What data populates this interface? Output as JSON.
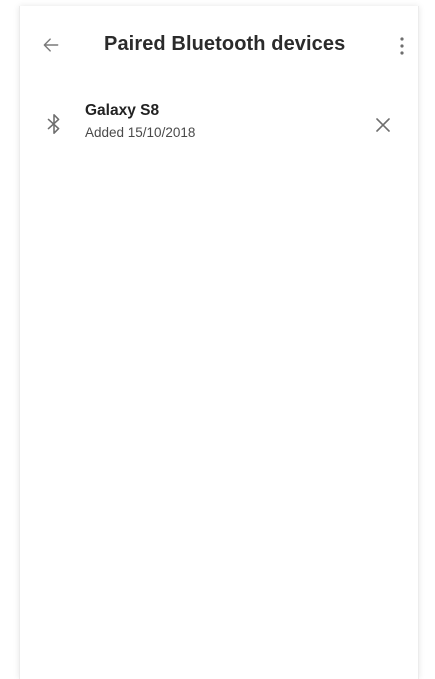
{
  "header": {
    "title": "Paired Bluetooth devices",
    "back_icon": "arrow-back-icon",
    "menu_icon": "more-vert-icon"
  },
  "devices": [
    {
      "name": "Galaxy S8",
      "added": "Added 15/10/2018",
      "icon": "bluetooth-icon",
      "remove_icon": "close-icon"
    }
  ],
  "colors": {
    "text_primary": "#2b2b2b",
    "text_secondary": "#4a4a4a",
    "icon": "#6e6e6e",
    "background": "#ffffff"
  }
}
